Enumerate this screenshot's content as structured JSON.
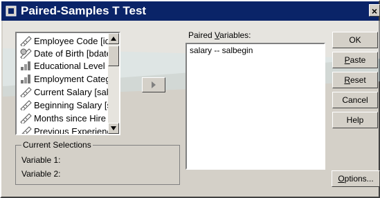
{
  "window": {
    "title": "Paired-Samples T Test",
    "close_glyph": "×"
  },
  "source_list": {
    "items": [
      {
        "label": "Employee Code [id]",
        "icon": "scale-variable-icon"
      },
      {
        "label": "Date of Birth [bdate",
        "icon": "date-variable-icon"
      },
      {
        "label": "Educational Level (",
        "icon": "ordinal-variable-icon"
      },
      {
        "label": "Employment Catego",
        "icon": "ordinal-variable-icon"
      },
      {
        "label": "Current Salary [sala",
        "icon": "scale-variable-icon"
      },
      {
        "label": "Beginning Salary [s",
        "icon": "scale-variable-icon"
      },
      {
        "label": "Months since Hire [",
        "icon": "scale-variable-icon"
      },
      {
        "label": "Previous Experienc",
        "icon": "scale-variable-icon"
      }
    ]
  },
  "paired": {
    "label_prefix": "Paired ",
    "label_mnemonic": "V",
    "label_suffix": "ariables:",
    "items": [
      "salary -- salbegin"
    ]
  },
  "buttons": {
    "ok": "OK",
    "paste_m": "P",
    "paste_rest": "aste",
    "reset_m": "R",
    "reset_rest": "eset",
    "cancel": "Cancel",
    "help": "Help",
    "options_m": "O",
    "options_rest": "ptions..."
  },
  "current_selections": {
    "title": "Current Selections",
    "variable1": "Variable 1:",
    "variable2": "Variable 2:"
  }
}
